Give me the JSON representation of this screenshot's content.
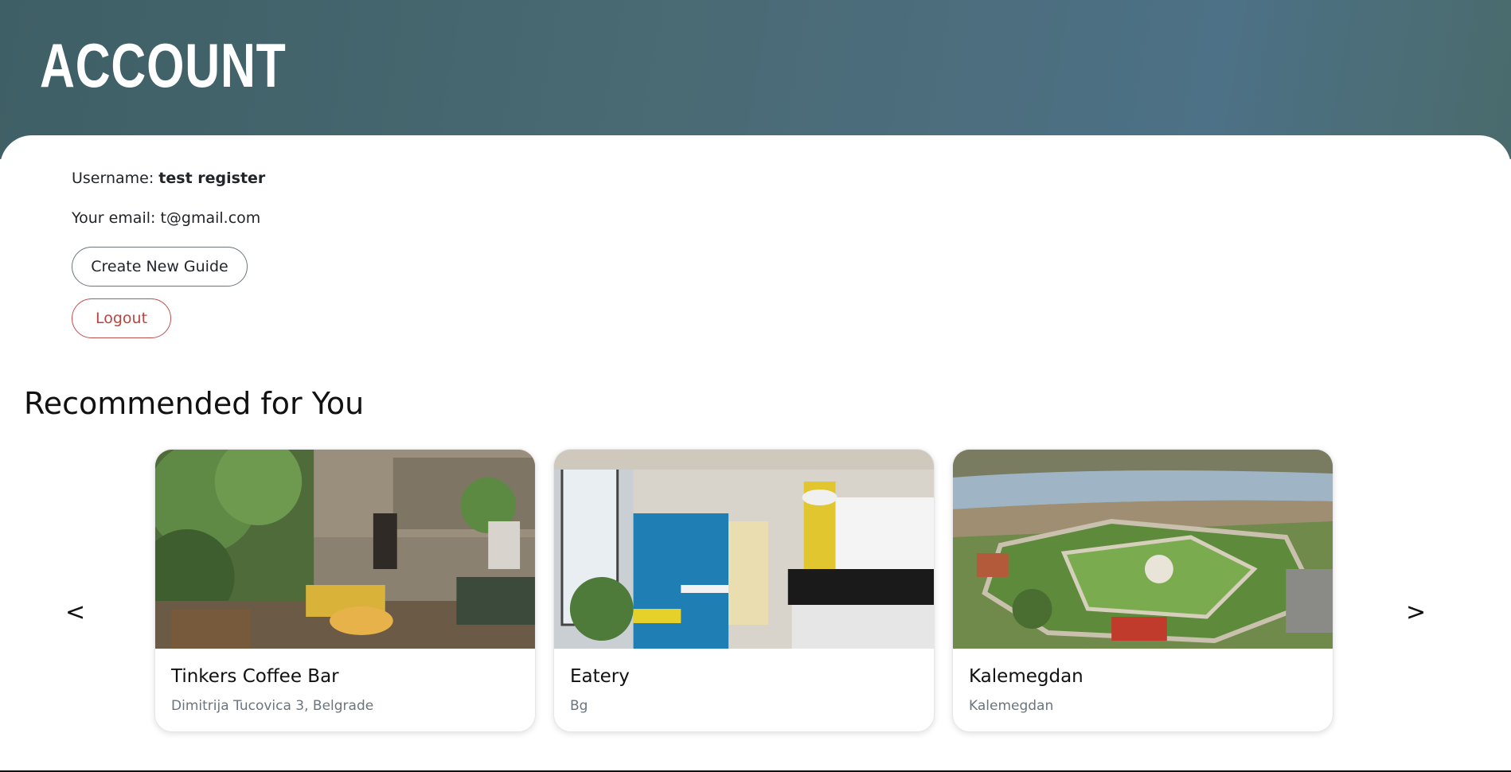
{
  "header": {
    "title": "ACCOUNT"
  },
  "account": {
    "username_label": "Username: ",
    "username_value": "test register",
    "email_label": "Your email: ",
    "email_value": "t@gmail.com",
    "create_guide_label": "Create New Guide",
    "logout_label": "Logout"
  },
  "recommended": {
    "title": "Recommended for You",
    "prev_label": "<",
    "next_label": ">",
    "cards": [
      {
        "title": "Tinkers Coffee Bar",
        "subtitle": "Dimitrija Tucovica 3, Belgrade"
      },
      {
        "title": "Eatery",
        "subtitle": "Bg"
      },
      {
        "title": "Kalemegdan",
        "subtitle": "Kalemegdan"
      }
    ]
  },
  "colors": {
    "hero": "#4a6a74",
    "logout": "#b8453f",
    "muted": "#6c757d"
  }
}
